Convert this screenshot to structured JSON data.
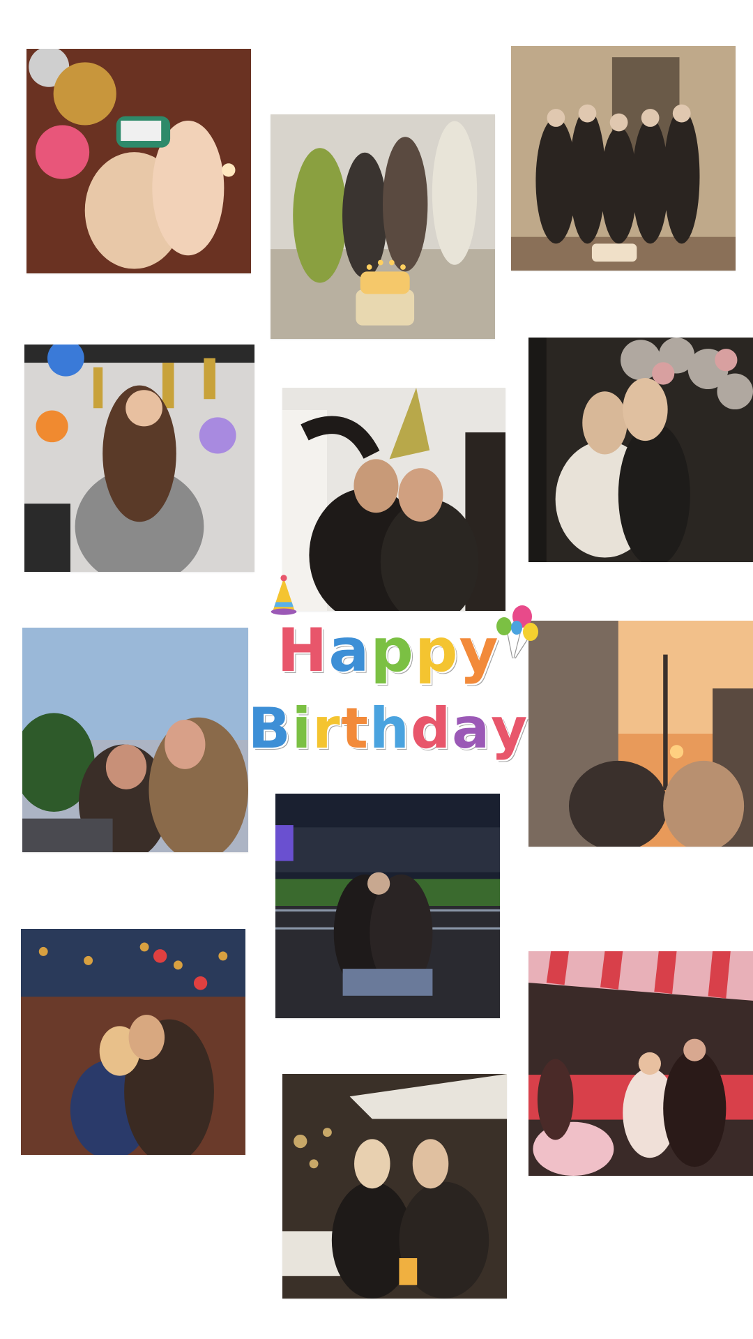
{
  "card": {
    "title_line1": "Happy",
    "title_line2": "Birthday",
    "letter_colors": [
      "#e8566b",
      "#3d8fd6",
      "#7bc043",
      "#f4c430",
      "#f28a3a",
      "#4aa3df",
      "#e8566b",
      "#9b59b6"
    ]
  },
  "photos": [
    {
      "name": "photo-balloons-hug",
      "palette": [
        "#5a2a1e",
        "#c8963c",
        "#e8567a",
        "#f2d2b8"
      ]
    },
    {
      "name": "photo-cake-candles",
      "palette": [
        "#d8d4cc",
        "#8a7a5e",
        "#3a3430",
        "#f5c86a"
      ]
    },
    {
      "name": "photo-group-hallway",
      "palette": [
        "#bfa98a",
        "#2a2420",
        "#e0c8b0",
        "#6a5a48"
      ]
    },
    {
      "name": "photo-party-blower",
      "palette": [
        "#d8d6d4",
        "#c8a23a",
        "#3a7ad8",
        "#8a7a6a"
      ]
    },
    {
      "name": "photo-party-hat-hug",
      "palette": [
        "#e8e6e2",
        "#1e1a18",
        "#c89a78",
        "#b8a84a"
      ]
    },
    {
      "name": "photo-silver-balloons",
      "palette": [
        "#2a2622",
        "#e8e2d8",
        "#b0a8a0",
        "#d8b898"
      ]
    },
    {
      "name": "photo-sky-selfie",
      "palette": [
        "#9ab8d8",
        "#2e5a2a",
        "#c89078",
        "#3a2e28"
      ]
    },
    {
      "name": "photo-sunset-street",
      "palette": [
        "#e89a5a",
        "#3a302c",
        "#7a6a5e",
        "#f2c08a"
      ]
    },
    {
      "name": "photo-night-bench",
      "palette": [
        "#1a2030",
        "#3a6a2e",
        "#2a2a30",
        "#8a96a8"
      ]
    },
    {
      "name": "photo-lights-kiss",
      "palette": [
        "#2a3a5a",
        "#d8a040",
        "#6a3a2a",
        "#e8c08a"
      ]
    },
    {
      "name": "photo-red-awning",
      "palette": [
        "#e8b0b8",
        "#3a2a28",
        "#d8404a",
        "#f0e0d8"
      ]
    },
    {
      "name": "photo-night-drink",
      "palette": [
        "#3a3028",
        "#c8a868",
        "#1e1a18",
        "#e8d0b0"
      ]
    }
  ]
}
